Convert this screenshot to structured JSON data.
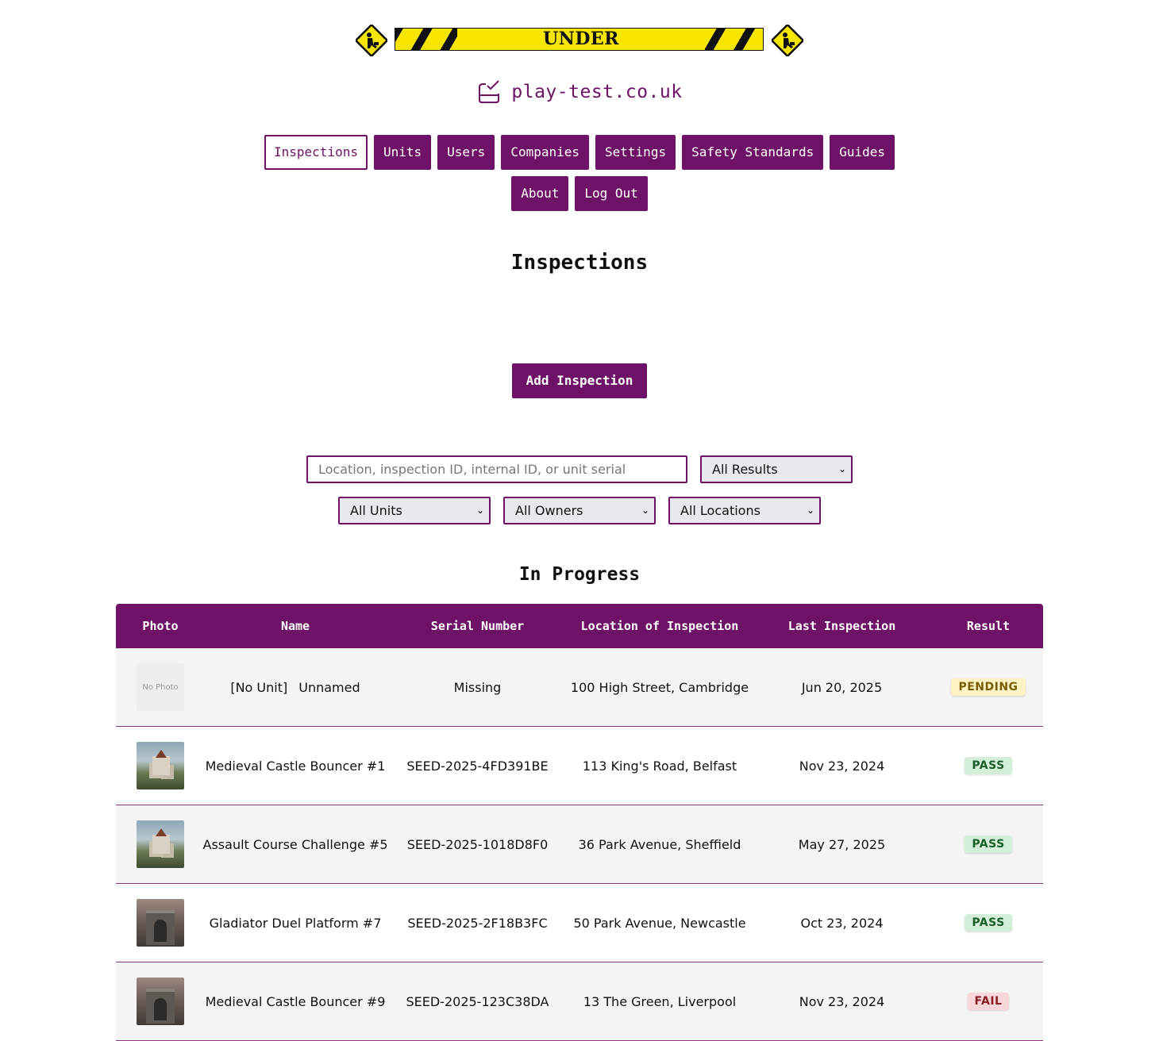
{
  "banner": {
    "text": "UNDER CONSTRUCTION"
  },
  "logo": {
    "text": "play-test.co.uk",
    "icon": "inspection-check-icon"
  },
  "nav": {
    "row1": [
      "Inspections",
      "Units",
      "Users",
      "Companies",
      "Settings",
      "Safety Standards",
      "Guides"
    ],
    "row2": [
      "About",
      "Log Out"
    ],
    "active": "Inspections"
  },
  "page": {
    "title": "Inspections",
    "add_button": "Add Inspection"
  },
  "filters": {
    "search_placeholder": "Location, inspection ID, internal ID, or unit serial",
    "results": "All Results",
    "units": "All Units",
    "owners": "All Owners",
    "locations": "All Locations"
  },
  "section": {
    "title": "In Progress"
  },
  "table": {
    "headers": [
      "Photo",
      "Name",
      "Serial Number",
      "Location of Inspection",
      "Last Inspection",
      "Result"
    ],
    "rows": [
      {
        "photo": "No Photo",
        "unit_tag": "[No Unit]",
        "name": "Unnamed",
        "serial": "Missing",
        "location": "100 High Street, Cambridge",
        "date": "Jun 20, 2025",
        "result": "PENDING"
      },
      {
        "photo": "",
        "unit_tag": "",
        "name": "Medieval Castle Bouncer #1",
        "serial": "SEED-2025-4FD391BE",
        "location": "113 King's Road, Belfast",
        "date": "Nov 23, 2024",
        "result": "PASS"
      },
      {
        "photo": "",
        "unit_tag": "",
        "name": "Assault Course Challenge #5",
        "serial": "SEED-2025-1018D8F0",
        "location": "36 Park Avenue, Sheffield",
        "date": "May 27, 2025",
        "result": "PASS"
      },
      {
        "photo": "",
        "unit_tag": "",
        "name": "Gladiator Duel Platform #7",
        "serial": "SEED-2025-2F18B3FC",
        "location": "50 Park Avenue, Newcastle",
        "date": "Oct 23, 2024",
        "result": "PASS"
      },
      {
        "photo": "",
        "unit_tag": "",
        "name": "Medieval Castle Bouncer #9",
        "serial": "SEED-2025-123C38DA",
        "location": "13 The Green, Liverpool",
        "date": "Nov 23, 2024",
        "result": "FAIL"
      }
    ]
  },
  "colors": {
    "brand": "#6d1266",
    "pass": "#1b5e2a",
    "pending": "#7a5c00",
    "fail": "#8a1c24"
  }
}
